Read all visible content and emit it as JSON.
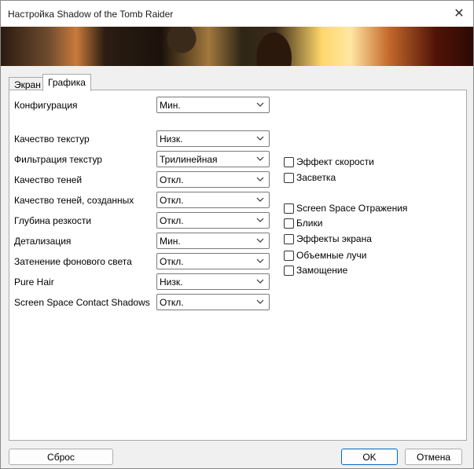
{
  "window": {
    "title": "Настройка Shadow of the Tomb Raider"
  },
  "tabs": [
    {
      "label": "Экран"
    },
    {
      "label": "Графика"
    }
  ],
  "settings": [
    {
      "label": "Конфигурация",
      "value": "Мин."
    },
    {
      "label": "Качество текстур",
      "value": "Низк."
    },
    {
      "label": "Фильтрация текстур",
      "value": "Трилинейная"
    },
    {
      "label": "Качество теней",
      "value": "Откл."
    },
    {
      "label": "Качество теней, созданных",
      "value": "Откл."
    },
    {
      "label": "Глубина резкости",
      "value": "Откл."
    },
    {
      "label": "Детализация",
      "value": "Мин."
    },
    {
      "label": "Затенение фонового света",
      "value": "Откл."
    },
    {
      "label": "Pure Hair",
      "value": "Низк."
    },
    {
      "label": "Screen Space Contact Shadows",
      "value": "Откл."
    }
  ],
  "checkboxes": [
    {
      "label": "Эффект скорости",
      "checked": false
    },
    {
      "label": "Засветка",
      "checked": false
    },
    {
      "label": "Screen Space Отражения",
      "checked": false
    },
    {
      "label": "Блики",
      "checked": false
    },
    {
      "label": "Эффекты экрана",
      "checked": false
    },
    {
      "label": "Объемные лучи",
      "checked": false
    },
    {
      "label": "Замощение",
      "checked": false
    }
  ],
  "buttons": {
    "reset": "Сброс",
    "ok": "OK",
    "cancel": "Отмена"
  }
}
